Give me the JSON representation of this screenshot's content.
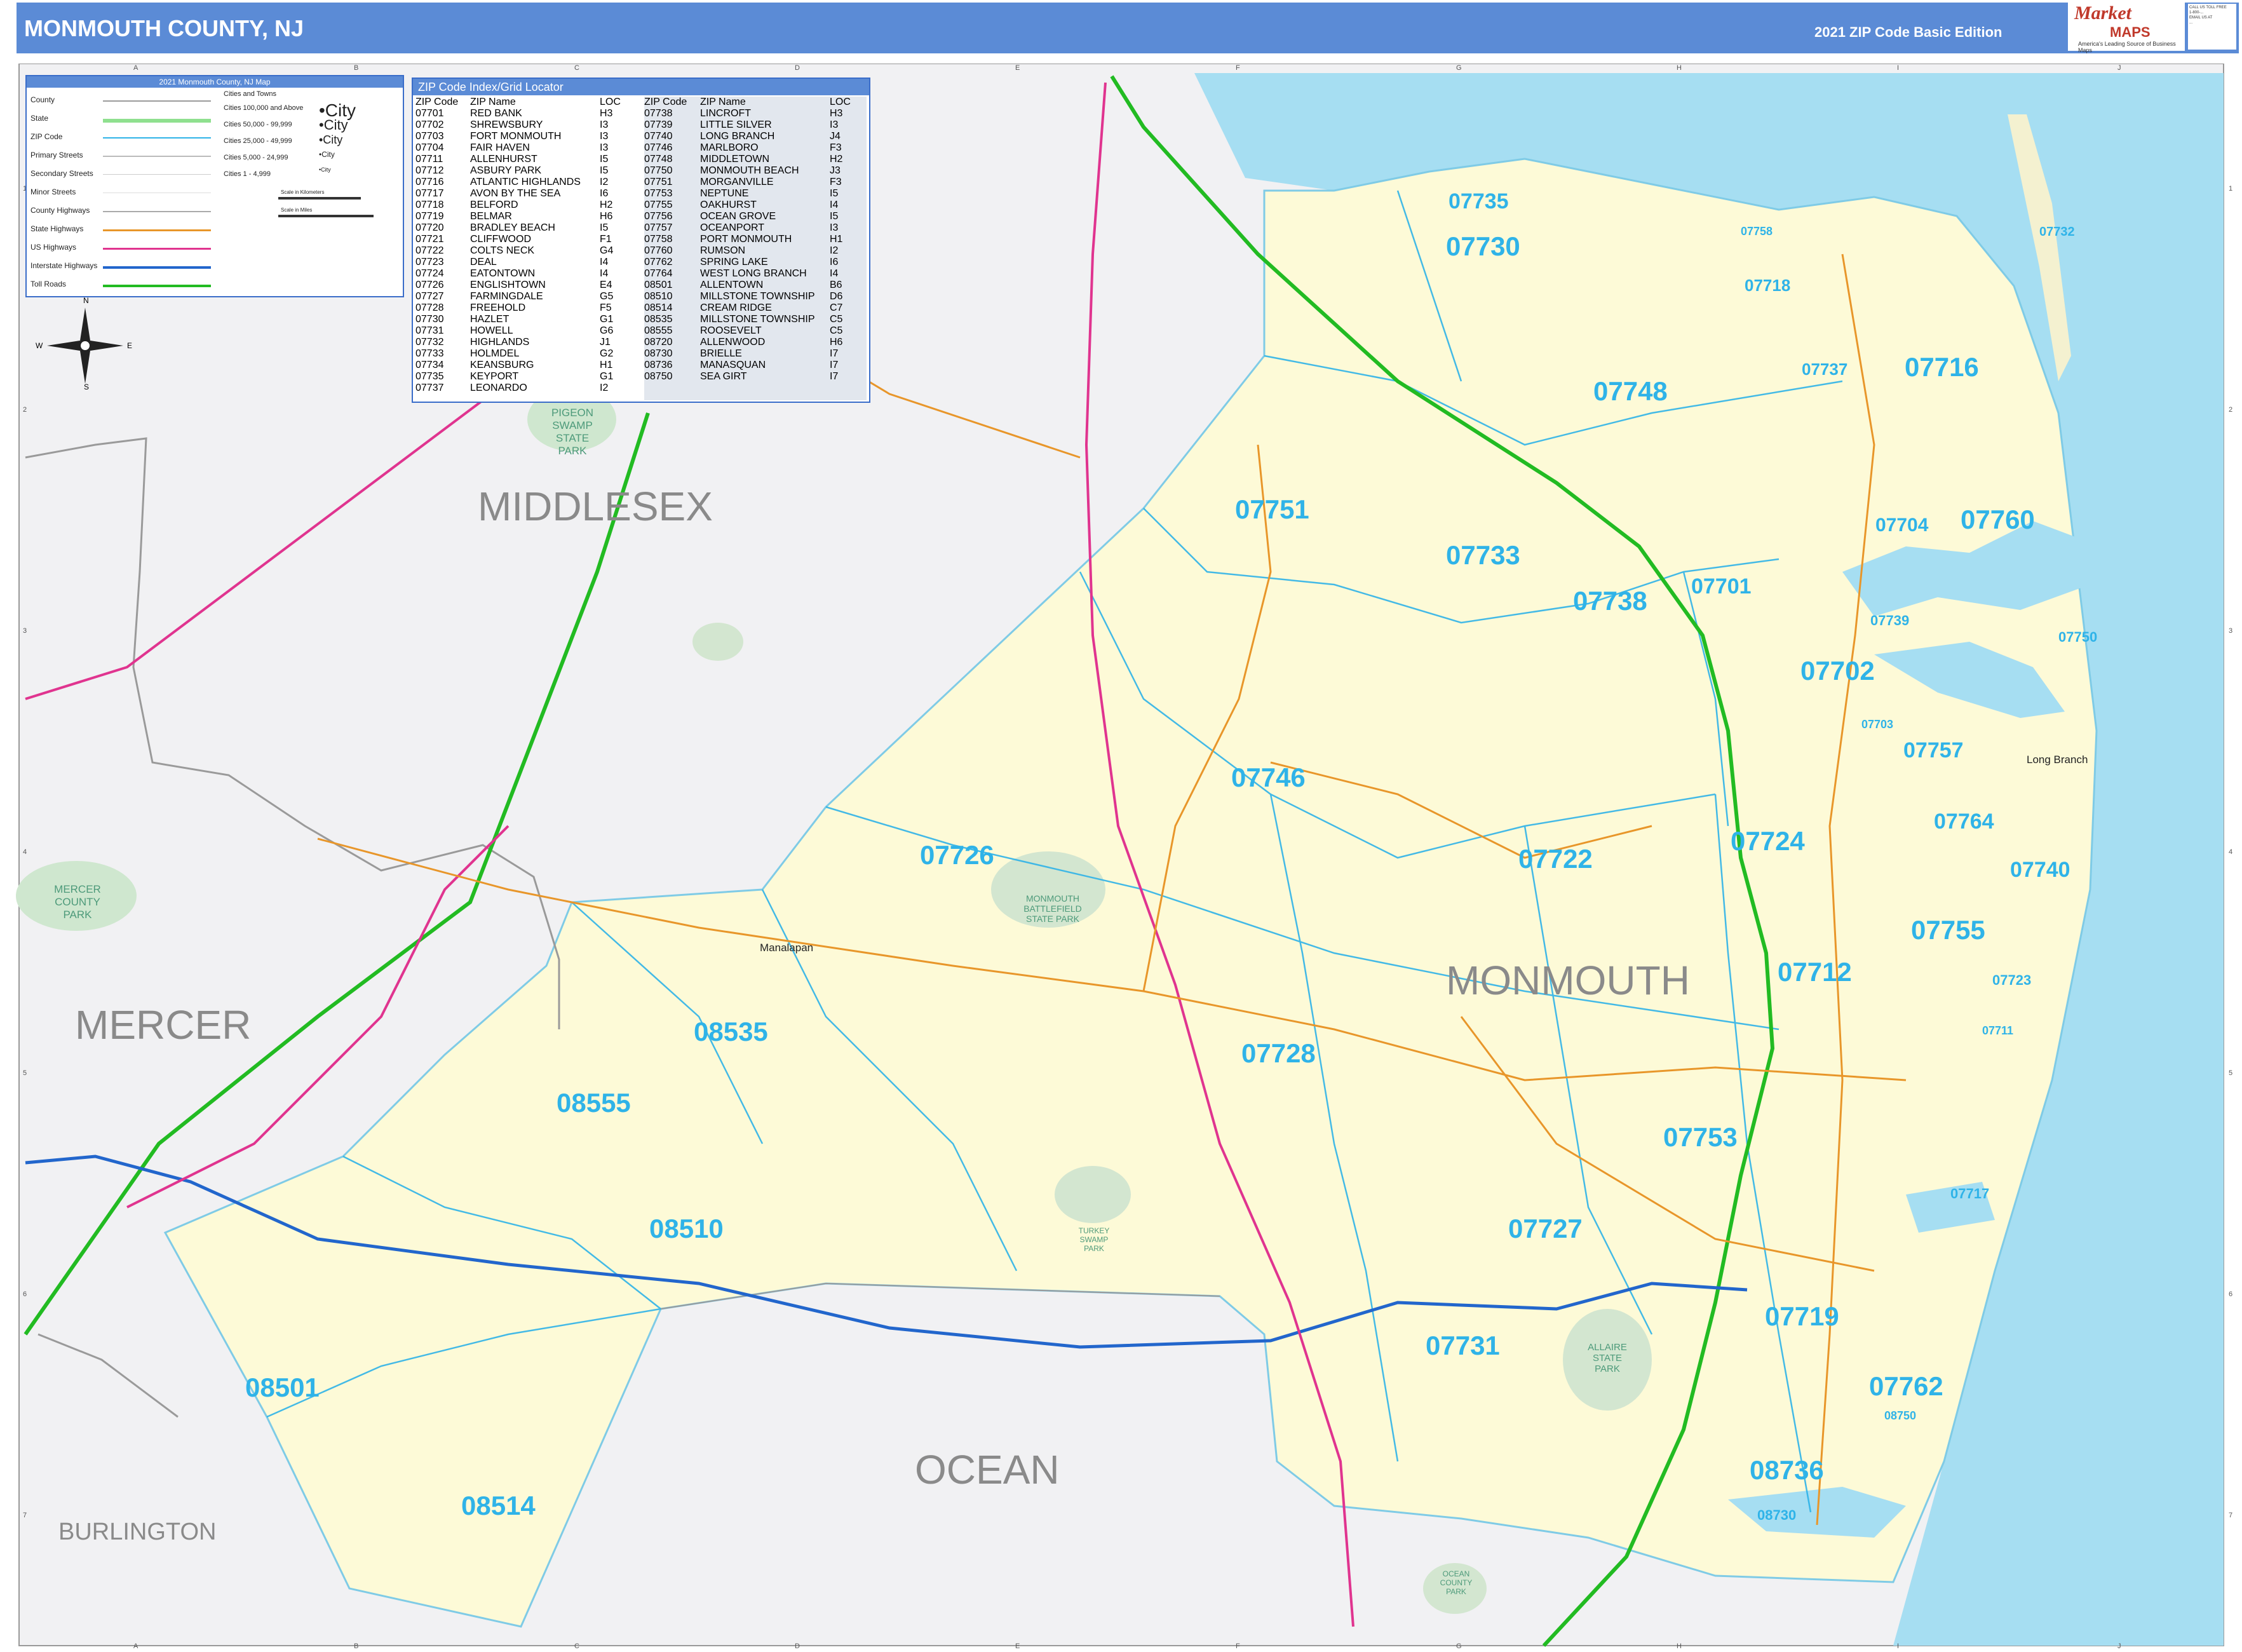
{
  "header": {
    "title": "MONMOUTH COUNTY, NJ",
    "edition": "2021 ZIP Code Basic Edition"
  },
  "logo": {
    "line1": "Market",
    "line2": "MAPS",
    "tagline": "America's Leading Source of Business Maps"
  },
  "contact": [
    "CALL US TOLL FREE",
    "1-800-...",
    "EMAIL US AT",
    "..."
  ],
  "legend": {
    "title": "2021 Monmouth County, NJ Map",
    "items": [
      "County",
      "State",
      "ZIP Code",
      "Primary Streets",
      "Secondary Streets",
      "Minor Streets",
      "County Highways",
      "State Highways",
      "US Highways",
      "Interstate Highways",
      "Toll Roads"
    ],
    "cities_title": "Cities and Towns",
    "cities": [
      "Cities 100,000 and Above",
      "Cities 50,000 - 99,999",
      "Cities 25,000 - 49,999",
      "Cities 5,000 - 24,999",
      "Cities 1 - 4,999"
    ],
    "city_word": "City",
    "scale_km": "Scale in Kilometers",
    "scale_mi": "Scale in Miles",
    "compass": {
      "n": "N",
      "s": "S",
      "e": "E",
      "w": "W"
    },
    "colors": {
      "county": "#9a9a9a",
      "state": "#8fe08f",
      "zip": "#2fb3e8",
      "primary": "#bbbbbb",
      "secondary": "#cccccc",
      "minor": "#dddddd",
      "county_hwy": "#aaaaaa",
      "state_hwy": "#e8962a",
      "us_hwy": "#e0348f",
      "interstate": "#2266cc",
      "toll": "#22bb22"
    }
  },
  "index": {
    "title": "ZIP Code Index/Grid Locator",
    "headers": [
      "ZIP Code",
      "ZIP Name",
      "LOC",
      "ZIP Code",
      "ZIP Name",
      "LOC"
    ],
    "rows": [
      [
        "07701",
        "RED BANK",
        "H3",
        "07738",
        "LINCROFT",
        "H3"
      ],
      [
        "07702",
        "SHREWSBURY",
        "I3",
        "07739",
        "LITTLE SILVER",
        "I3"
      ],
      [
        "07703",
        "FORT MONMOUTH",
        "I3",
        "07740",
        "LONG BRANCH",
        "J4"
      ],
      [
        "07704",
        "FAIR HAVEN",
        "I3",
        "07746",
        "MARLBORO",
        "F3"
      ],
      [
        "07711",
        "ALLENHURST",
        "I5",
        "07748",
        "MIDDLETOWN",
        "H2"
      ],
      [
        "07712",
        "ASBURY PARK",
        "I5",
        "07750",
        "MONMOUTH BEACH",
        "J3"
      ],
      [
        "07716",
        "ATLANTIC HIGHLANDS",
        "I2",
        "07751",
        "MORGANVILLE",
        "F3"
      ],
      [
        "07717",
        "AVON BY THE SEA",
        "I6",
        "07753",
        "NEPTUNE",
        "I5"
      ],
      [
        "07718",
        "BELFORD",
        "H2",
        "07755",
        "OAKHURST",
        "I4"
      ],
      [
        "07719",
        "BELMAR",
        "H6",
        "07756",
        "OCEAN GROVE",
        "I5"
      ],
      [
        "07720",
        "BRADLEY BEACH",
        "I5",
        "07757",
        "OCEANPORT",
        "I3"
      ],
      [
        "07721",
        "CLIFFWOOD",
        "F1",
        "07758",
        "PORT MONMOUTH",
        "H1"
      ],
      [
        "07722",
        "COLTS NECK",
        "G4",
        "07760",
        "RUMSON",
        "I2"
      ],
      [
        "07723",
        "DEAL",
        "I4",
        "07762",
        "SPRING LAKE",
        "I6"
      ],
      [
        "07724",
        "EATONTOWN",
        "I4",
        "07764",
        "WEST LONG BRANCH",
        "I4"
      ],
      [
        "07726",
        "ENGLISHTOWN",
        "E4",
        "08501",
        "ALLENTOWN",
        "B6"
      ],
      [
        "07727",
        "FARMINGDALE",
        "G5",
        "08510",
        "MILLSTONE TOWNSHIP",
        "D6"
      ],
      [
        "07728",
        "FREEHOLD",
        "F5",
        "08514",
        "CREAM RIDGE",
        "C7"
      ],
      [
        "07730",
        "HAZLET",
        "G1",
        "08535",
        "MILLSTONE TOWNSHIP",
        "C5"
      ],
      [
        "07731",
        "HOWELL",
        "G6",
        "08555",
        "ROOSEVELT",
        "C5"
      ],
      [
        "07732",
        "HIGHLANDS",
        "J1",
        "08720",
        "ALLENWOOD",
        "H6"
      ],
      [
        "07733",
        "HOLMDEL",
        "G2",
        "08730",
        "BRIELLE",
        "I7"
      ],
      [
        "07734",
        "KEANSBURG",
        "H1",
        "08736",
        "MANASQUAN",
        "I7"
      ],
      [
        "07735",
        "KEYPORT",
        "G1",
        "08750",
        "SEA GIRT",
        "I7"
      ],
      [
        "07737",
        "LEONARDO",
        "I2",
        "",
        "",
        ""
      ]
    ]
  },
  "counties": [
    "MIDDLESEX",
    "MERCER",
    "MONMOUTH",
    "OCEAN",
    "BURLINGTON"
  ],
  "zips": {
    "z07735": "07735",
    "z07730": "07730",
    "z07748": "07748",
    "z07716": "07716",
    "z07751": "07751",
    "z07733": "07733",
    "z07738": "07738",
    "z07701": "07701",
    "z07760": "07760",
    "z07704": "07704",
    "z07702": "07702",
    "z07757": "07757",
    "z07746": "07746",
    "z07726": "07726",
    "z07722": "07722",
    "z07724": "07724",
    "z07764": "07764",
    "z07740": "07740",
    "z07755": "07755",
    "z07712": "07712",
    "z08535": "08535",
    "z07728": "07728",
    "z08555": "08555",
    "z07753": "07753",
    "z08510": "08510",
    "z07727": "07727",
    "z07719": "07719",
    "z07731": "07731",
    "z08501": "08501",
    "z07762": "07762",
    "z08736": "08736",
    "z08514": "08514",
    "z07718": "07718",
    "z07737": "07737",
    "z07758": "07758",
    "z07732": "07732",
    "z07739": "07739",
    "z07750": "07750",
    "z07723": "07723",
    "z07717": "07717",
    "z08750": "08750",
    "z08730": "08730",
    "z07703": "07703",
    "z07711": "07711"
  },
  "towns": {
    "manalapan": "Manalapan",
    "long_branch": "Long Branch"
  },
  "parks": {
    "pigeon": "PIGEON SWAMP STATE PARK",
    "mercer": "MERCER COUNTY PARK",
    "battlefield": "MONMOUTH BATTLEFIELD STATE PARK",
    "allaire": "ALLAIRE STATE PARK",
    "turkey": "TURKEY SWAMP PARK",
    "ocean_county": "OCEAN COUNTY PARK"
  },
  "grid": {
    "cols": [
      "A",
      "B",
      "C",
      "D",
      "E",
      "F",
      "G",
      "H",
      "I",
      "J"
    ],
    "rows": [
      "1",
      "2",
      "3",
      "4",
      "5",
      "6",
      "7"
    ]
  }
}
